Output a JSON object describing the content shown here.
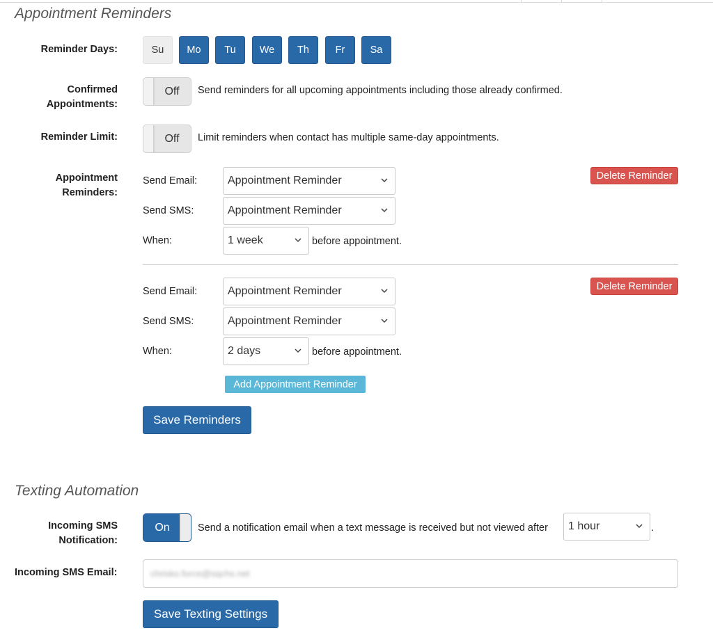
{
  "reminders_section": {
    "title": "Appointment Reminders",
    "reminder_days_label": "Reminder Days:",
    "days": [
      {
        "label": "Su",
        "active": false
      },
      {
        "label": "Mo",
        "active": true
      },
      {
        "label": "Tu",
        "active": true
      },
      {
        "label": "We",
        "active": true
      },
      {
        "label": "Th",
        "active": true
      },
      {
        "label": "Fr",
        "active": true
      },
      {
        "label": "Sa",
        "active": true
      }
    ],
    "confirmed_label_line1": "Confirmed",
    "confirmed_label_line2": "Appointments:",
    "confirmed_toggle": "Off",
    "confirmed_desc": "Send reminders for all upcoming appointments including those already confirmed.",
    "limit_label": "Reminder Limit:",
    "limit_toggle": "Off",
    "limit_desc": "Limit reminders when contact has multiple same-day appointments.",
    "appt_label_line1": "Appointment",
    "appt_label_line2": "Reminders:",
    "reminders": [
      {
        "send_email_label": "Send Email:",
        "send_email_value": "Appointment Reminder",
        "send_sms_label": "Send SMS:",
        "send_sms_value": "Appointment Reminder",
        "when_label": "When:",
        "when_value": "1 week",
        "when_suffix": "before appointment.",
        "delete_label": "Delete Reminder"
      },
      {
        "send_email_label": "Send Email:",
        "send_email_value": "Appointment Reminder",
        "send_sms_label": "Send SMS:",
        "send_sms_value": "Appointment Reminder",
        "when_label": "When:",
        "when_value": "2 days",
        "when_suffix": "before appointment.",
        "delete_label": "Delete Reminder"
      }
    ],
    "add_label": "Add Appointment Reminder",
    "save_label": "Save Reminders"
  },
  "texting_section": {
    "title": "Texting Automation",
    "incoming_label_line1": "Incoming SMS",
    "incoming_label_line2": "Notification:",
    "incoming_toggle": "On",
    "incoming_desc": "Send a notification email when a text message is received but not viewed after",
    "incoming_after_value": "1 hour",
    "incoming_period": ".",
    "email_label": "Incoming SMS Email:",
    "email_value": "chrisko.force@sqchs.net",
    "save_label": "Save Texting Settings"
  },
  "colors": {
    "primary": "#2a69a8",
    "danger": "#d9534f",
    "info": "#5bb7d8"
  }
}
